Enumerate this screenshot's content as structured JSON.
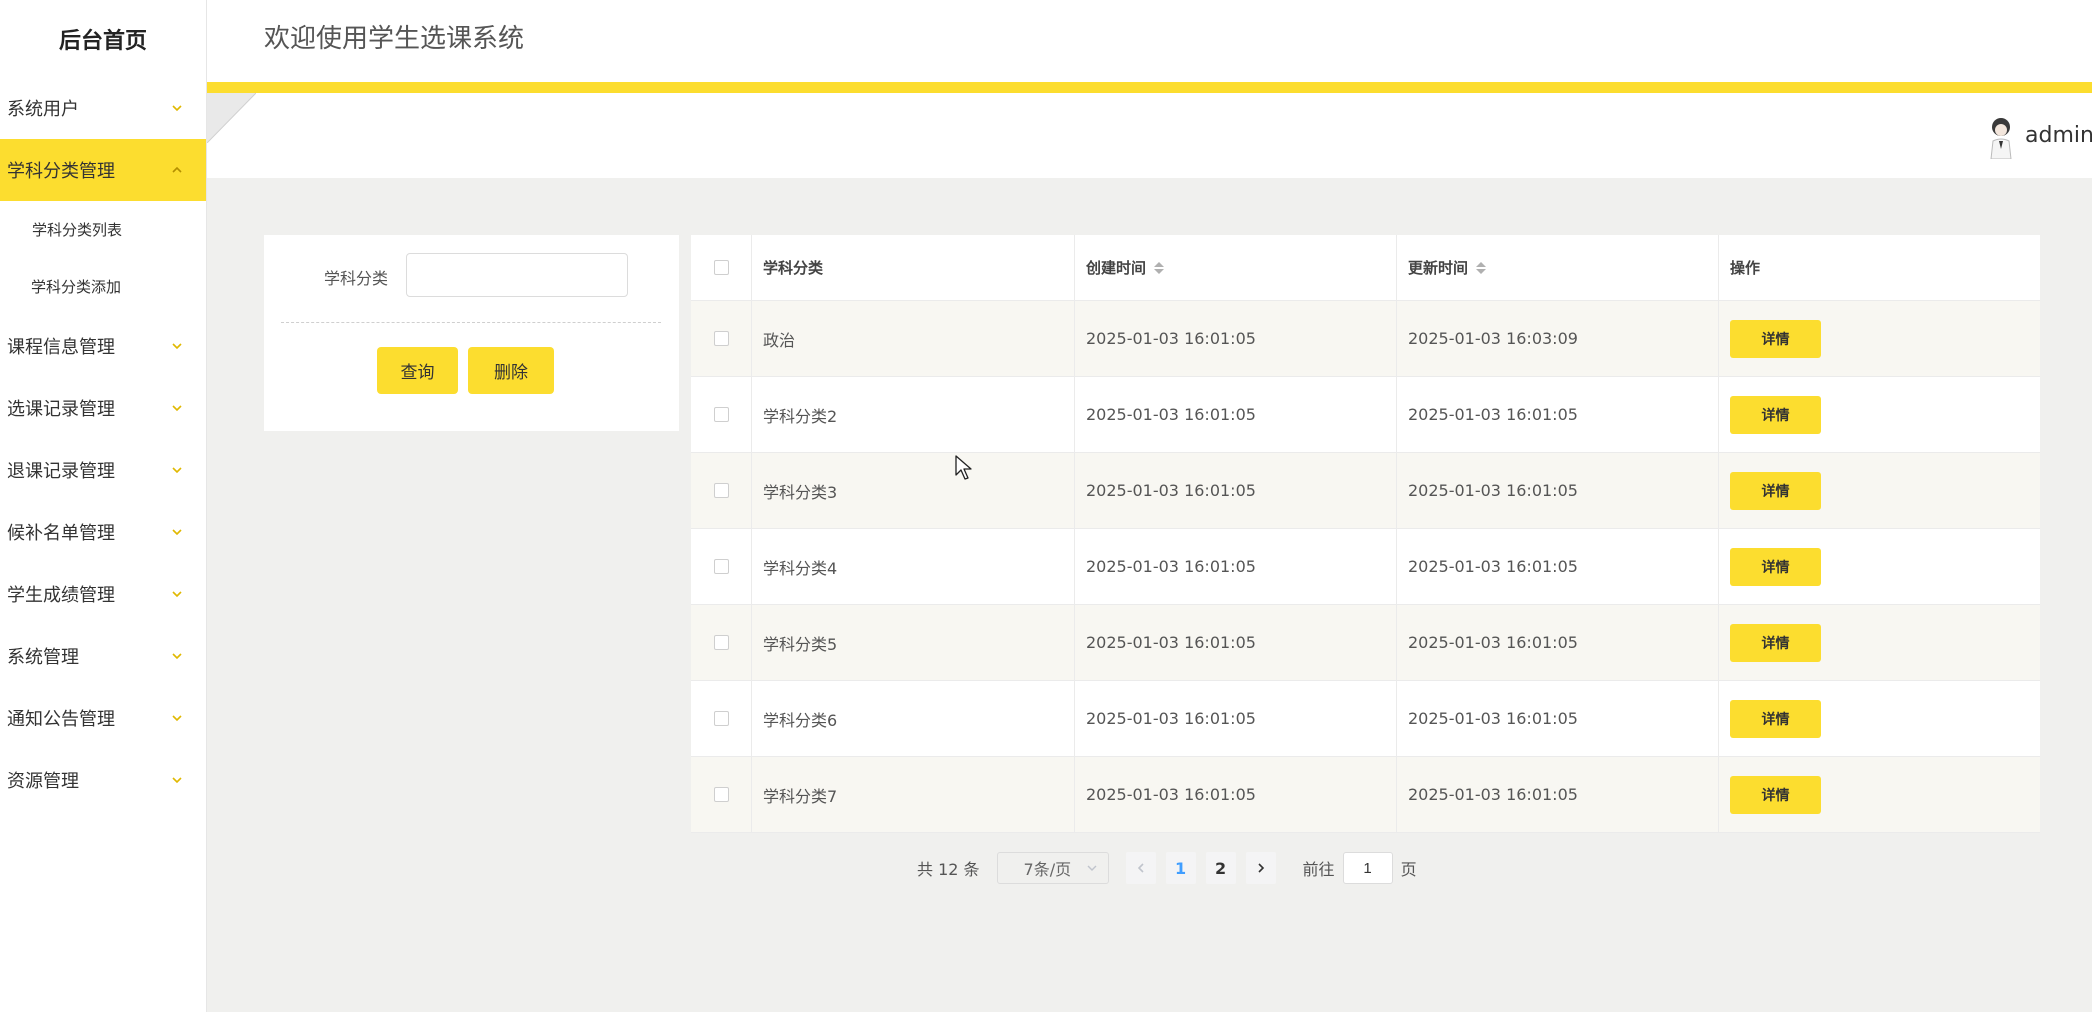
{
  "sidebar": {
    "brand": "后台首页",
    "items": [
      {
        "label": "系统用户"
      },
      {
        "label": "学科分类管理",
        "expanded": true,
        "children": [
          {
            "label": "学科分类列表"
          },
          {
            "label": "学科分类添加"
          }
        ]
      },
      {
        "label": "课程信息管理"
      },
      {
        "label": "选课记录管理"
      },
      {
        "label": "退课记录管理"
      },
      {
        "label": "候补名单管理"
      },
      {
        "label": "学生成绩管理"
      },
      {
        "label": "系统管理"
      },
      {
        "label": "通知公告管理"
      },
      {
        "label": "资源管理"
      }
    ]
  },
  "header": {
    "title": "欢迎使用学生选课系统",
    "username": "admin"
  },
  "search": {
    "label": "学科分类",
    "value": "",
    "query_label": "查询",
    "delete_label": "删除"
  },
  "table": {
    "columns": [
      "学科分类",
      "创建时间",
      "更新时间",
      "操作"
    ],
    "rows": [
      {
        "category": "政治",
        "created": "2025-01-03 16:01:05",
        "updated": "2025-01-03 16:03:09",
        "action": "详情"
      },
      {
        "category": "学科分类2",
        "created": "2025-01-03 16:01:05",
        "updated": "2025-01-03 16:01:05",
        "action": "详情"
      },
      {
        "category": "学科分类3",
        "created": "2025-01-03 16:01:05",
        "updated": "2025-01-03 16:01:05",
        "action": "详情"
      },
      {
        "category": "学科分类4",
        "created": "2025-01-03 16:01:05",
        "updated": "2025-01-03 16:01:05",
        "action": "详情"
      },
      {
        "category": "学科分类5",
        "created": "2025-01-03 16:01:05",
        "updated": "2025-01-03 16:01:05",
        "action": "详情"
      },
      {
        "category": "学科分类6",
        "created": "2025-01-03 16:01:05",
        "updated": "2025-01-03 16:01:05",
        "action": "详情"
      },
      {
        "category": "学科分类7",
        "created": "2025-01-03 16:01:05",
        "updated": "2025-01-03 16:01:05",
        "action": "详情"
      }
    ]
  },
  "pagination": {
    "total": "共 12 条",
    "page_size": "7条/页",
    "pages": [
      "1",
      "2"
    ],
    "current": "1",
    "goto_prefix": "前往",
    "goto_value": "1",
    "goto_suffix": "页"
  },
  "colors": {
    "accent": "#fcdd2f",
    "page_bg": "#f0f0ee",
    "active_page": "#409eff"
  },
  "icons": [
    "chevron-down-icon",
    "chevron-up-icon",
    "chevron-left-icon",
    "chevron-right-icon",
    "sort-icon",
    "avatar",
    "cursor-icon"
  ]
}
